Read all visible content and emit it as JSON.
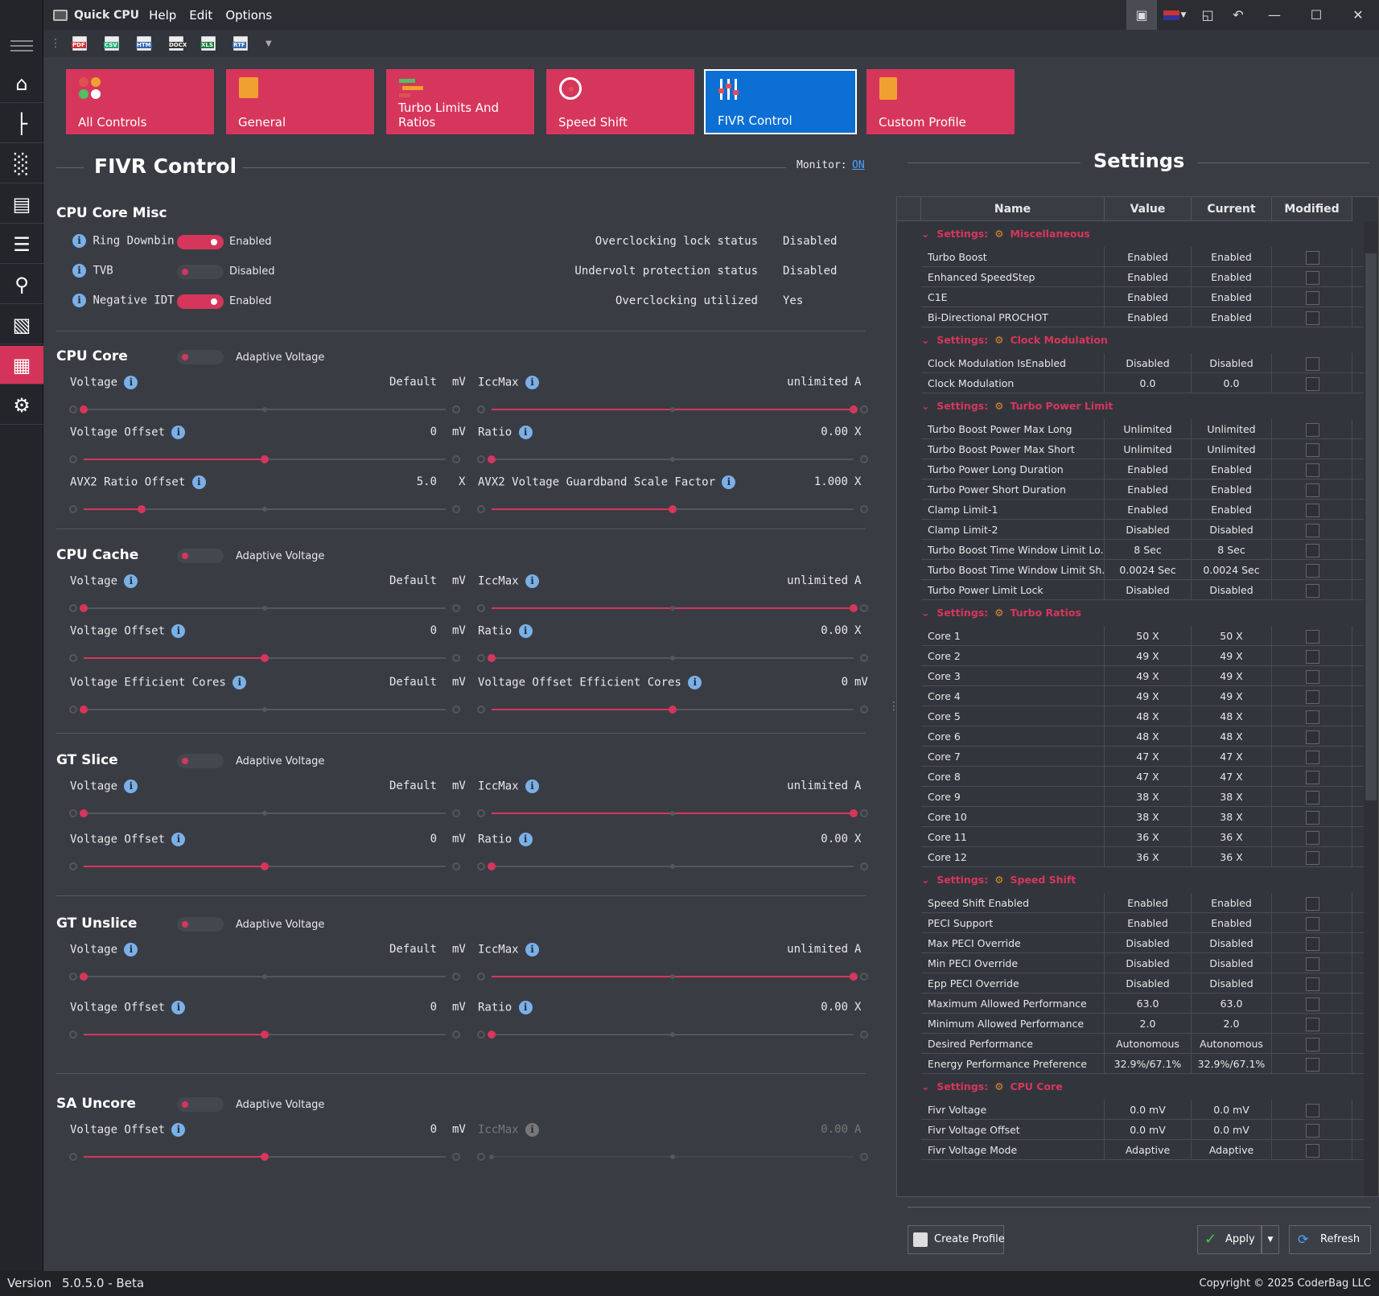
{
  "titlebar": {
    "app_title": "Quick CPU",
    "menus": [
      "Help",
      "Edit",
      "Options"
    ]
  },
  "toolbar": {
    "file_types": [
      "PDF",
      "CSV",
      "HTM",
      "DOCX",
      "XLS",
      "RTF"
    ]
  },
  "tiles": [
    "All Controls",
    "General",
    "Turbo Limits And Ratios",
    "Speed Shift",
    "FIVR Control",
    "Custom Profile"
  ],
  "page": {
    "title": "FIVR Control",
    "monitor_label": "Monitor:",
    "monitor_value": "ON"
  },
  "misc": {
    "title": "CPU Core Misc",
    "toggles": [
      {
        "label": "Ring Downbin",
        "state": "Enabled"
      },
      {
        "label": "TVB",
        "state": "Disabled"
      },
      {
        "label": "Negative IDT",
        "state": "Enabled"
      }
    ],
    "status": [
      {
        "label": "Overclocking lock status",
        "value": "Disabled"
      },
      {
        "label": "Undervolt protection status",
        "value": "Disabled"
      },
      {
        "label": "Overclocking utilized",
        "value": "Yes"
      }
    ]
  },
  "sections": {
    "core": {
      "title": "CPU Core",
      "adaptive": "Adaptive Voltage",
      "voltage": {
        "label": "Voltage",
        "value": "Default",
        "unit": "mV"
      },
      "iccmax": {
        "label": "IccMax",
        "value": "unlimited",
        "unit": "A"
      },
      "offset": {
        "label": "Voltage Offset",
        "value": "0",
        "unit": "mV"
      },
      "ratio": {
        "label": "Ratio",
        "value": "0.00",
        "unit": "X"
      },
      "avx2": {
        "label": "AVX2 Ratio Offset",
        "value": "5.0",
        "unit": "X"
      },
      "avx2gb": {
        "label": "AVX2 Voltage Guardband Scale Factor",
        "value": "1.000",
        "unit": "X"
      }
    },
    "cache": {
      "title": "CPU Cache",
      "adaptive": "Adaptive Voltage",
      "voltage": {
        "label": "Voltage",
        "value": "Default",
        "unit": "mV"
      },
      "iccmax": {
        "label": "IccMax",
        "value": "unlimited",
        "unit": "A"
      },
      "offset": {
        "label": "Voltage Offset",
        "value": "0",
        "unit": "mV"
      },
      "ratio": {
        "label": "Ratio",
        "value": "0.00",
        "unit": "X"
      },
      "veff": {
        "label": "Voltage Efficient Cores",
        "value": "Default",
        "unit": "mV"
      },
      "voeff": {
        "label": "Voltage Offset Efficient Cores",
        "value": "0",
        "unit": "mV"
      }
    },
    "gtslice": {
      "title": "GT Slice",
      "adaptive": "Adaptive Voltage",
      "voltage": {
        "label": "Voltage",
        "value": "Default",
        "unit": "mV"
      },
      "iccmax": {
        "label": "IccMax",
        "value": "unlimited",
        "unit": "A"
      },
      "offset": {
        "label": "Voltage Offset",
        "value": "0",
        "unit": "mV"
      },
      "ratio": {
        "label": "Ratio",
        "value": "0.00",
        "unit": "X"
      }
    },
    "gtunslice": {
      "title": "GT Unslice",
      "adaptive": "Adaptive Voltage",
      "voltage": {
        "label": "Voltage",
        "value": "Default",
        "unit": "mV"
      },
      "iccmax": {
        "label": "IccMax",
        "value": "unlimited",
        "unit": "A"
      },
      "offset": {
        "label": "Voltage Offset",
        "value": "0",
        "unit": "mV"
      },
      "ratio": {
        "label": "Ratio",
        "value": "0.00",
        "unit": "X"
      }
    },
    "sa": {
      "title": "SA Uncore",
      "adaptive": "Adaptive Voltage",
      "offset": {
        "label": "Voltage Offset",
        "value": "0",
        "unit": "mV"
      },
      "iccmax": {
        "label": "IccMax",
        "value": "0.00",
        "unit": "A"
      }
    }
  },
  "settings": {
    "title": "Settings",
    "headers": [
      "Name",
      "Value",
      "Current",
      "Modified"
    ],
    "group_prefix": "Settings:",
    "groups": [
      {
        "name": "Miscellaneous",
        "rows": [
          [
            "Turbo Boost",
            "Enabled",
            "Enabled"
          ],
          [
            "Enhanced SpeedStep",
            "Enabled",
            "Enabled"
          ],
          [
            "C1E",
            "Enabled",
            "Enabled"
          ],
          [
            "Bi-Directional PROCHOT",
            "Enabled",
            "Enabled"
          ]
        ]
      },
      {
        "name": "Clock Modulation",
        "rows": [
          [
            "Clock Modulation IsEnabled",
            "Disabled",
            "Disabled"
          ],
          [
            "Clock Modulation",
            "0.0",
            "0.0"
          ]
        ]
      },
      {
        "name": "Turbo Power Limit",
        "rows": [
          [
            "Turbo Boost Power Max Long",
            "Unlimited",
            "Unlimited"
          ],
          [
            "Turbo Boost Power Max Short",
            "Unlimited",
            "Unlimited"
          ],
          [
            "Turbo Power Long Duration",
            "Enabled",
            "Enabled"
          ],
          [
            "Turbo Power Short Duration",
            "Enabled",
            "Enabled"
          ],
          [
            "Clamp Limit-1",
            "Enabled",
            "Enabled"
          ],
          [
            "Clamp Limit-2",
            "Disabled",
            "Disabled"
          ],
          [
            "Turbo Boost Time Window Limit Lo...",
            "8 Sec",
            "8 Sec"
          ],
          [
            "Turbo Boost Time Window Limit Sh...",
            "0.0024 Sec",
            "0.0024 Sec"
          ],
          [
            "Turbo Power Limit Lock",
            "Disabled",
            "Disabled"
          ]
        ]
      },
      {
        "name": "Turbo Ratios",
        "rows": [
          [
            "Core 1",
            "50 X",
            "50 X"
          ],
          [
            "Core 2",
            "49 X",
            "49 X"
          ],
          [
            "Core 3",
            "49 X",
            "49 X"
          ],
          [
            "Core 4",
            "49 X",
            "49 X"
          ],
          [
            "Core 5",
            "48 X",
            "48 X"
          ],
          [
            "Core 6",
            "48 X",
            "48 X"
          ],
          [
            "Core 7",
            "47 X",
            "47 X"
          ],
          [
            "Core 8",
            "47 X",
            "47 X"
          ],
          [
            "Core 9",
            "38 X",
            "38 X"
          ],
          [
            "Core 10",
            "38 X",
            "38 X"
          ],
          [
            "Core 11",
            "36 X",
            "36 X"
          ],
          [
            "Core 12",
            "36 X",
            "36 X"
          ]
        ]
      },
      {
        "name": "Speed Shift",
        "rows": [
          [
            "Speed Shift Enabled",
            "Enabled",
            "Enabled"
          ],
          [
            "PECI Support",
            "Enabled",
            "Enabled"
          ],
          [
            "Max PECI Override",
            "Disabled",
            "Disabled"
          ],
          [
            "Min PECI Override",
            "Disabled",
            "Disabled"
          ],
          [
            "Epp PECI Override",
            "Disabled",
            "Disabled"
          ],
          [
            "Maximum Allowed Performance",
            "63.0",
            "63.0"
          ],
          [
            "Minimum Allowed Performance",
            "2.0",
            "2.0"
          ],
          [
            "Desired Performance",
            "Autonomous",
            "Autonomous"
          ],
          [
            "Energy Performance Preference",
            "32.9%/67.1%",
            "32.9%/67.1%"
          ]
        ]
      },
      {
        "name": "CPU Core",
        "rows": [
          [
            "Fivr Voltage",
            "0.0 mV",
            "0.0 mV"
          ],
          [
            "Fivr Voltage Offset",
            "0.0 mV",
            "0.0 mV"
          ],
          [
            "Fivr Voltage Mode",
            "Adaptive",
            "Adaptive"
          ]
        ]
      }
    ]
  },
  "buttons": {
    "create_profile": "Create Profile",
    "apply": "Apply",
    "refresh": "Refresh"
  },
  "status": {
    "version_label": "Version",
    "version": "5.0.5.0 - Beta",
    "copyright": "Copyright © 2025 CoderBag LLC"
  },
  "colors": {
    "accent": "#d6365c",
    "active_tile": "#0c6fd4",
    "background": "#3a3c44"
  }
}
